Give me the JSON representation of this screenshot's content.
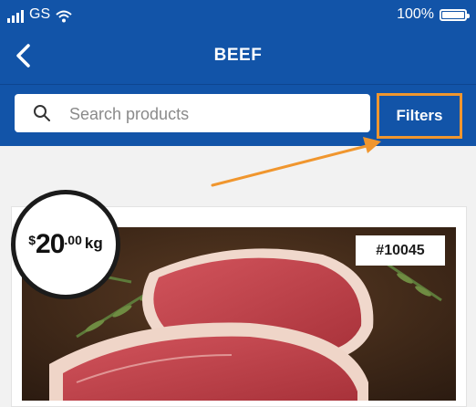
{
  "status_bar": {
    "carrier": "GS",
    "battery": "100%",
    "icons": [
      "signal-icon",
      "wifi-icon",
      "battery-icon"
    ]
  },
  "header": {
    "title": "BEEF",
    "back_icon": "chevron-left-icon"
  },
  "search": {
    "placeholder": "Search products",
    "icon": "search-icon"
  },
  "filters": {
    "label": "Filters"
  },
  "product": {
    "id_badge": "#10045",
    "price": {
      "currency": "$",
      "whole": "20",
      "decimal": ".00",
      "unit": "kg"
    },
    "image": "raw beef steaks with rosemary"
  },
  "colors": {
    "header": "#1254a8",
    "highlight": "#f0962e",
    "background": "#f2f2f2"
  }
}
